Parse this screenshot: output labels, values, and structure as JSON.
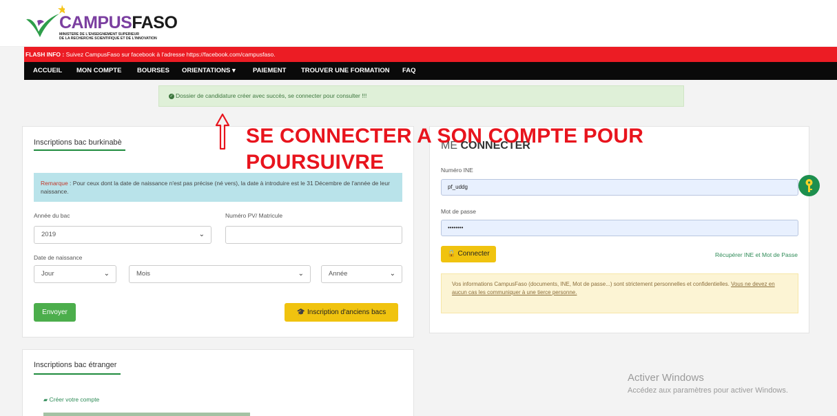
{
  "header": {
    "brand_part1": "CAMPUS",
    "brand_part2": "FASO",
    "ministry": "MINISTERE DE L'ENSEIGNEMENT SUPERIEUR\nDE LA RECHERCHE SCIENTIFIQUE ET DE L'INNOVATION"
  },
  "flash": {
    "label": "FLASH INFO :",
    "text": " Suivez CampusFaso sur facebook à l'adresse https://facebook.com/campusfaso."
  },
  "nav": {
    "items": [
      "ACCUEIL",
      "MON COMPTE",
      "BOURSES",
      "ORIENTATIONS ▾",
      "PAIEMENT",
      "TROUVER UNE FORMATION",
      "FAQ"
    ]
  },
  "alert": {
    "icon": "check-circle-icon",
    "text": "Dossier de candidature créer avec succès, se connecter pour consulter !!!"
  },
  "annotation": {
    "line1": "SE CONNECTER A SON COMPTE POUR",
    "line2": "POURSUIVRE",
    "icon": "arrow-up-icon"
  },
  "bac_burkinabe": {
    "title": "Inscriptions bac burkinabè",
    "remarque_label": "Remarque",
    "remarque_text": " : Pour ceux dont la date de naissance n'est pas précise (né vers), la date à introduire est le 31 Décembre de l'année de leur naissance.",
    "annee_label": "Année du bac",
    "annee_value": "2019",
    "pv_label": "Numéro PV/ Matricule",
    "pv_value": "",
    "naissance_label": "Date de naissance",
    "jour": "Jour",
    "mois": "Mois",
    "annee": "Année",
    "envoyer": "Envoyer",
    "anciens": "Inscription d'anciens bacs"
  },
  "bac_etranger": {
    "title": "Inscriptions bac étranger",
    "creer": "Créer votre compte"
  },
  "login": {
    "title_light": "ME ",
    "title_bold": "CONNECTER",
    "ine_label": "Numéro INE",
    "ine_value": "pf_uddg",
    "pass_label": "Mot de passe",
    "pass_value": "••••••••",
    "connect": "Connecter",
    "recover": "Récupérer INE et Mot de Passe",
    "warning_text": "Vos informations CampusFaso (documents, INE, Mot de passe...) sont strictement personnelles et confidentielles. ",
    "warning_link": "Vous ne devez en aucun cas les communiquer à une tierce personne."
  },
  "watermark": {
    "line1": "Activer Windows",
    "line2": "Accédez aux paramètres pour activer Windows."
  },
  "colors": {
    "flash_red": "#ec1c24",
    "nav_black": "#0a0a0a",
    "accent_green": "#1e8a3c",
    "button_yellow": "#f0c30f",
    "annotation_red": "#e8141d"
  }
}
